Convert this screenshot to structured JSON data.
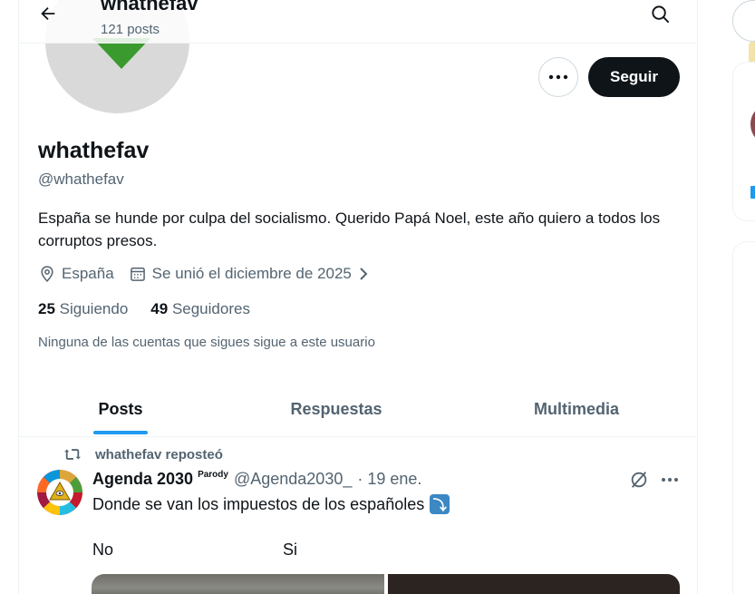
{
  "header": {
    "title": "whathefav",
    "posts_count": "121 posts"
  },
  "profile": {
    "name": "whathefav",
    "handle": "@whathefav",
    "bio": "España se hunde por culpa del socialismo. Querido Papá Noel, este año quiero a todos los corruptos presos.",
    "location": "España",
    "joined": "Se unió el diciembre de 2025",
    "following_count": "25",
    "following_label": "Siguiendo",
    "followers_count": "49",
    "followers_label": "Seguidores",
    "mutual_note": "Ninguna de las cuentas que sigues sigue a este usuario",
    "follow_button": "Seguir"
  },
  "tabs": [
    {
      "label": "Posts",
      "active": true
    },
    {
      "label": "Respuestas",
      "active": false
    },
    {
      "label": "Multimedia",
      "active": false
    }
  ],
  "post": {
    "repost_label": "whathefav reposteó",
    "author_name": "Agenda 2030",
    "badge": "Parody",
    "author_handle": "@Agenda2030_",
    "date": "· 19 ene.",
    "text": "Donde se van los impuestos de los españoles",
    "emoji": "⤵",
    "choice_left": "No",
    "choice_right": "Si"
  },
  "colors": {
    "accent": "#1d9bf0",
    "follow_button_bg": "#0f1419",
    "secondary_text": "#536471"
  },
  "icons": {
    "back": "arrow-left-icon",
    "search": "search-icon",
    "more": "more-horizontal-icon",
    "location": "location-pin-icon",
    "calendar": "calendar-icon",
    "repost": "repost-icon",
    "grok": "grok-icon"
  }
}
